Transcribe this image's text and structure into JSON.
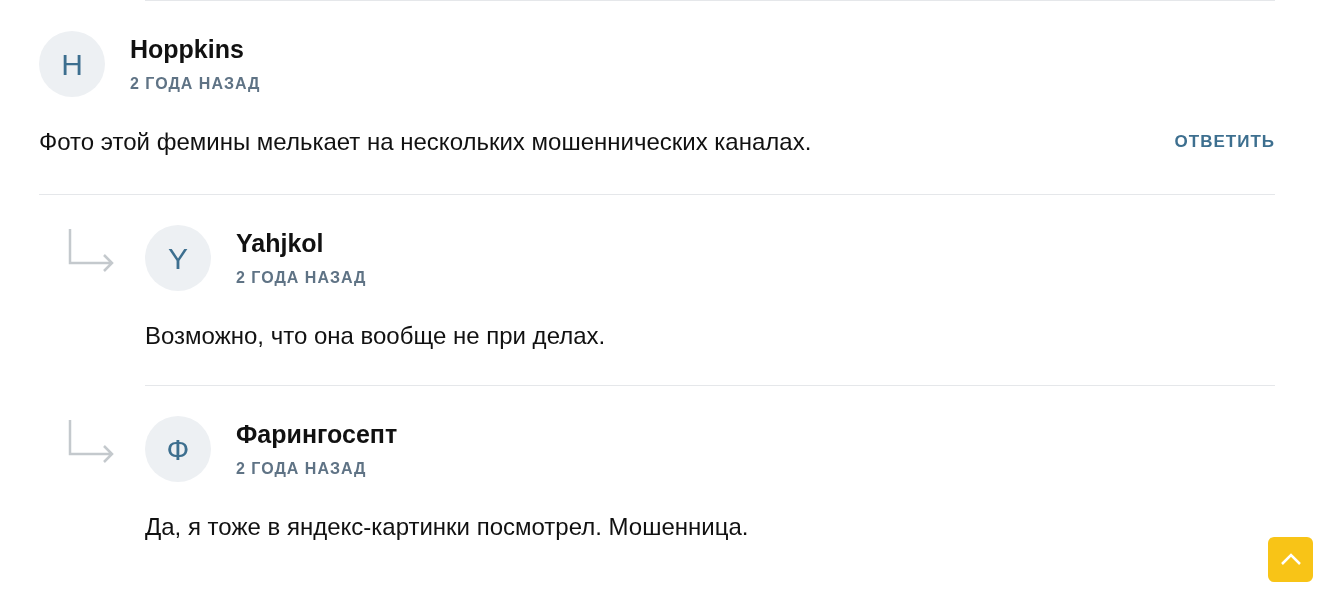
{
  "comments": [
    {
      "author": "Hoppkins",
      "initial": "H",
      "time": "2 ГОДА НАЗАД",
      "text": "Фото этой фемины мелькает на нескольких мошеннических каналах.",
      "reply_label": "ОТВЕТИТЬ",
      "children": [
        {
          "author": "Yahjkol",
          "initial": "Y",
          "time": "2 ГОДА НАЗАД",
          "text": "Возможно, что она вообще не при делах."
        },
        {
          "author": "Фарингосепт",
          "initial": "Ф",
          "time": "2 ГОДА НАЗАД",
          "text": "Да, я тоже в яндекс-картинки посмотрел. Мошенница."
        }
      ]
    }
  ]
}
